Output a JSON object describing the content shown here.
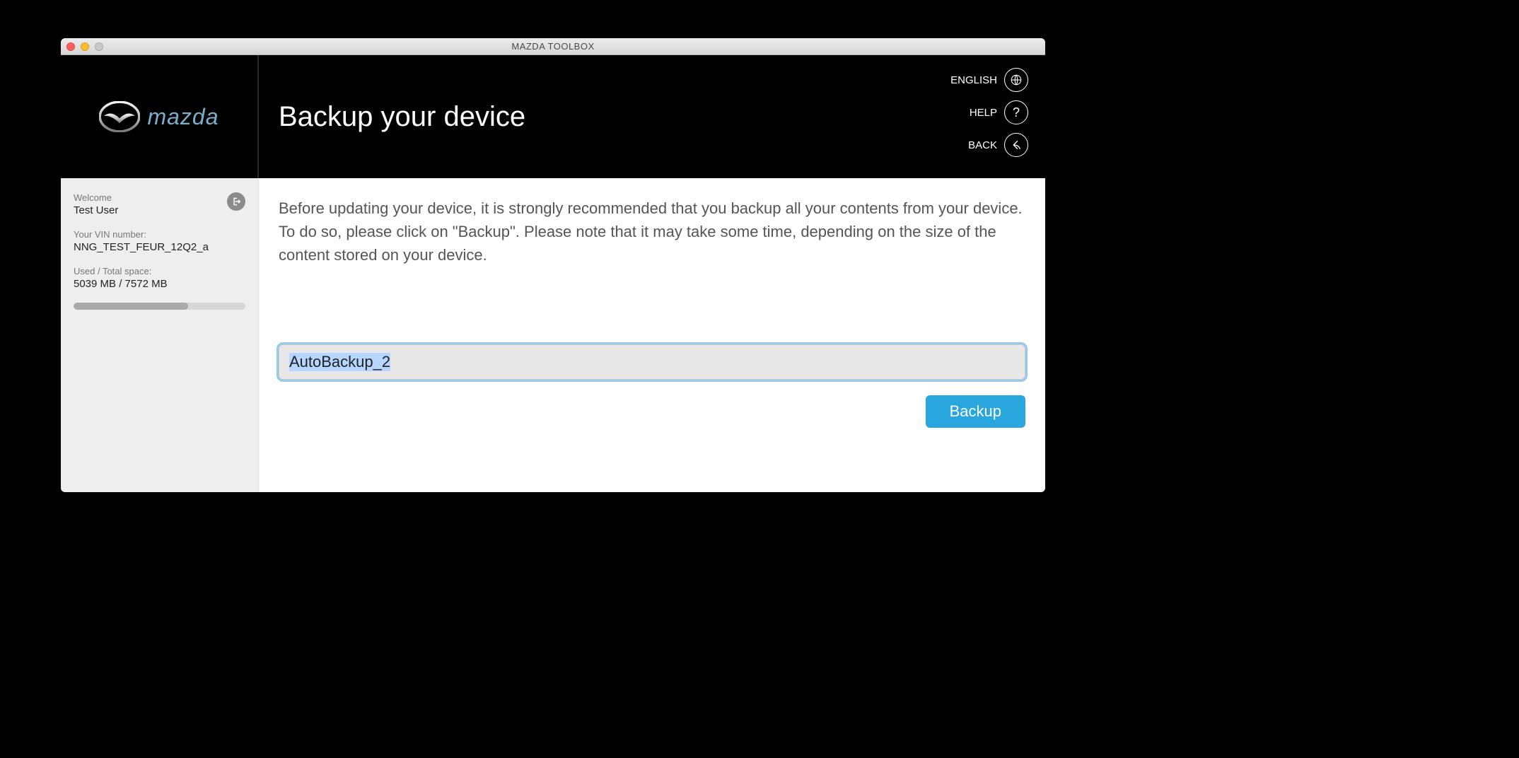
{
  "window": {
    "title": "MAZDA TOOLBOX"
  },
  "brand": {
    "name": "mazda"
  },
  "header": {
    "page_title": "Backup your device",
    "actions": {
      "language_label": "ENGLISH",
      "help_label": "HELP",
      "back_label": "BACK"
    }
  },
  "sidebar": {
    "welcome_label": "Welcome",
    "user_name": "Test User",
    "vin_label": "Your VIN number:",
    "vin_value": "NNG_TEST_FEUR_12Q2_a",
    "space_label": "Used / Total space:",
    "space_value": "5039 MB / 7572 MB",
    "space_used": 5039,
    "space_total": 7572
  },
  "main": {
    "description": "Before updating your device, it is strongly recommended that you backup all your contents from your device. To do so, please click on \"Backup\". Please note that it may take some time, depending on the size of the content stored on your device.",
    "backup_name_value": "AutoBackup_2",
    "backup_button_label": "Backup"
  }
}
